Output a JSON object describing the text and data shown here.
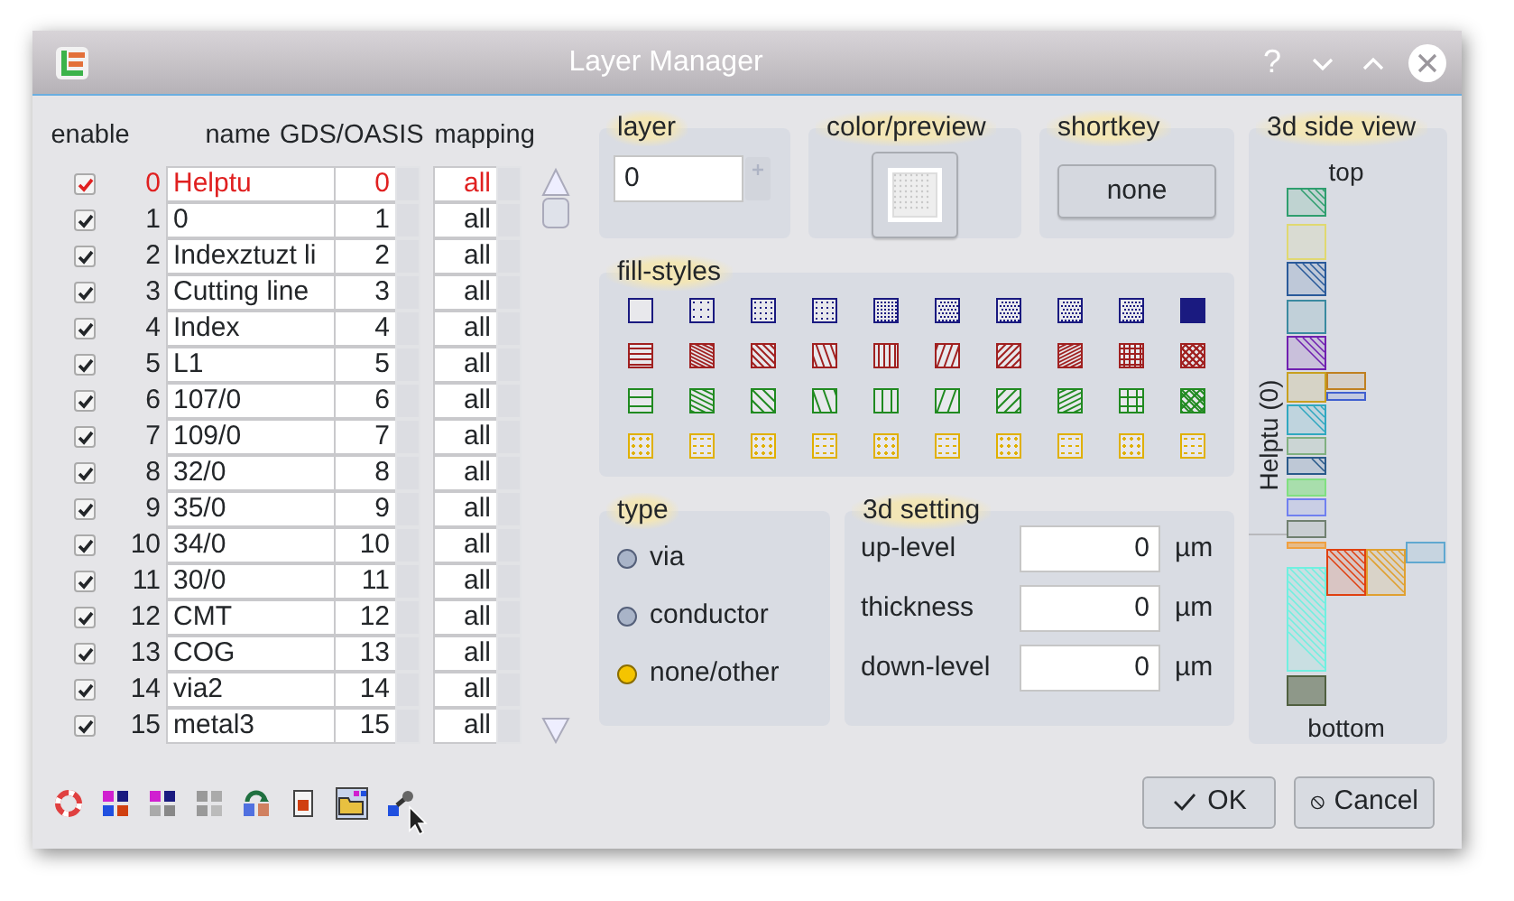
{
  "window": {
    "title": "Layer Manager",
    "help": "?"
  },
  "layer_table": {
    "columns": [
      "enable",
      "name",
      "GDS/OASIS",
      "mapping"
    ],
    "rows": [
      {
        "index": "0",
        "name": "Helptu",
        "gds": "0",
        "mapping": "all",
        "enabled": true,
        "selected": true
      },
      {
        "index": "1",
        "name": "0",
        "gds": "1",
        "mapping": "all",
        "enabled": true,
        "selected": false
      },
      {
        "index": "2",
        "name": "Indexztuzt li",
        "gds": "2",
        "mapping": "all",
        "enabled": true,
        "selected": false
      },
      {
        "index": "3",
        "name": "Cutting line",
        "gds": "3",
        "mapping": "all",
        "enabled": true,
        "selected": false
      },
      {
        "index": "4",
        "name": "Index",
        "gds": "4",
        "mapping": "all",
        "enabled": true,
        "selected": false
      },
      {
        "index": "5",
        "name": "L1",
        "gds": "5",
        "mapping": "all",
        "enabled": true,
        "selected": false
      },
      {
        "index": "6",
        "name": "107/0",
        "gds": "6",
        "mapping": "all",
        "enabled": true,
        "selected": false
      },
      {
        "index": "7",
        "name": "109/0",
        "gds": "7",
        "mapping": "all",
        "enabled": true,
        "selected": false
      },
      {
        "index": "8",
        "name": "32/0",
        "gds": "8",
        "mapping": "all",
        "enabled": true,
        "selected": false
      },
      {
        "index": "9",
        "name": "35/0",
        "gds": "9",
        "mapping": "all",
        "enabled": true,
        "selected": false
      },
      {
        "index": "10",
        "name": "34/0",
        "gds": "10",
        "mapping": "all",
        "enabled": true,
        "selected": false
      },
      {
        "index": "11",
        "name": "30/0",
        "gds": "11",
        "mapping": "all",
        "enabled": true,
        "selected": false
      },
      {
        "index": "12",
        "name": "CMT",
        "gds": "12",
        "mapping": "all",
        "enabled": true,
        "selected": false
      },
      {
        "index": "13",
        "name": "COG",
        "gds": "13",
        "mapping": "all",
        "enabled": true,
        "selected": false
      },
      {
        "index": "14",
        "name": "via2",
        "gds": "14",
        "mapping": "all",
        "enabled": true,
        "selected": false
      },
      {
        "index": "15",
        "name": "metal3",
        "gds": "15",
        "mapping": "all",
        "enabled": true,
        "selected": false
      }
    ]
  },
  "layer": {
    "title": "layer",
    "value": "0"
  },
  "color_preview": {
    "title": "color/preview"
  },
  "shortkey": {
    "title": "shortkey",
    "button": "none"
  },
  "fill_styles": {
    "title": "fill-styles",
    "rows": [
      {
        "color": "#1a1a80"
      },
      {
        "color": "#a02020"
      },
      {
        "color": "#208a20"
      },
      {
        "color": "#e0b000"
      }
    ]
  },
  "type": {
    "title": "type",
    "options": [
      {
        "label": "via",
        "selected": false
      },
      {
        "label": "conductor",
        "selected": false
      },
      {
        "label": "none/other",
        "selected": true
      }
    ]
  },
  "setting_3d": {
    "title": "3d setting",
    "fields": [
      {
        "label": "up-level",
        "value": "0",
        "unit": "µm"
      },
      {
        "label": "thickness",
        "value": "0",
        "unit": "µm"
      },
      {
        "label": "down-level",
        "value": "0",
        "unit": "µm"
      }
    ]
  },
  "side_view": {
    "title": "3d side view",
    "top": "top",
    "bottom": "bottom",
    "layer_label": "Helptu (0)"
  },
  "buttons": [
    {
      "label": "OK",
      "kind": "ok"
    },
    {
      "label": "Cancel",
      "kind": "cancel"
    }
  ]
}
